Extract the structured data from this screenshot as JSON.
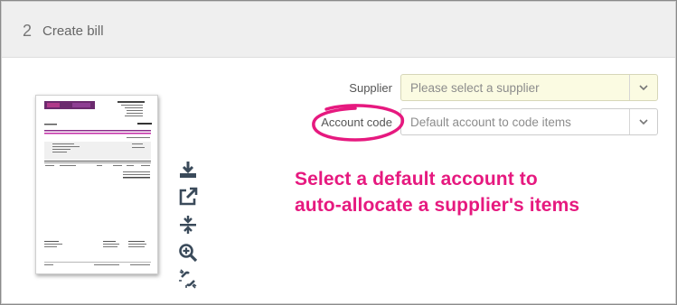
{
  "step": {
    "number": "2",
    "title": "Create bill"
  },
  "fields": {
    "supplier": {
      "label": "Supplier",
      "placeholder": "Please select a supplier"
    },
    "account_code": {
      "label": "Account code",
      "placeholder": "Default account to code items"
    }
  },
  "callout": {
    "line1": "Select a default account to",
    "line2": "auto-allocate a supplier's items"
  },
  "invoice_tools": [
    "download-icon",
    "open-external-icon",
    "fit-height-icon",
    "zoom-in-icon",
    "unlink-icon"
  ],
  "colors": {
    "accent": "#e6197f",
    "supplier_field_bg": "#fbfbe2",
    "header_bg": "#efefef",
    "icon": "#3a4a5a"
  }
}
